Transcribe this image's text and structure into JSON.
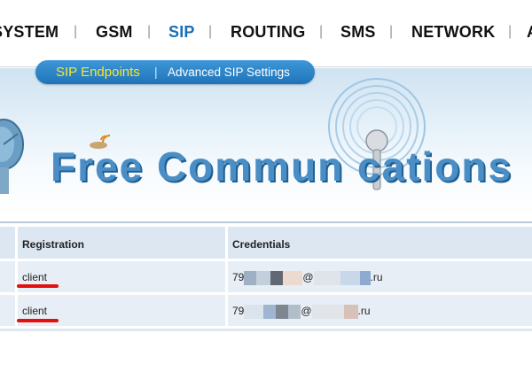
{
  "nav": {
    "items": [
      "SYSTEM",
      "GSM",
      "SIP",
      "ROUTING",
      "SMS",
      "NETWORK",
      "A"
    ],
    "separator": "|",
    "active": "SIP"
  },
  "subtabs": {
    "items": [
      "SIP Endpoints",
      "Advanced SIP Settings"
    ],
    "separator": "|"
  },
  "banner": {
    "title": "Free Commun cations"
  },
  "table": {
    "headers": [
      "Registration",
      "Credentials"
    ],
    "rows": [
      {
        "registration": "client",
        "cred_prefix": "79",
        "cred_at": "@",
        "cred_domain": ".ru"
      },
      {
        "registration": "client",
        "cred_prefix": "79",
        "cred_at": "@",
        "cred_domain": ".ru"
      }
    ]
  },
  "colors": {
    "accent": "#1a6fb5",
    "tab_active": "#f7e72f",
    "highlight": "#e31010"
  }
}
